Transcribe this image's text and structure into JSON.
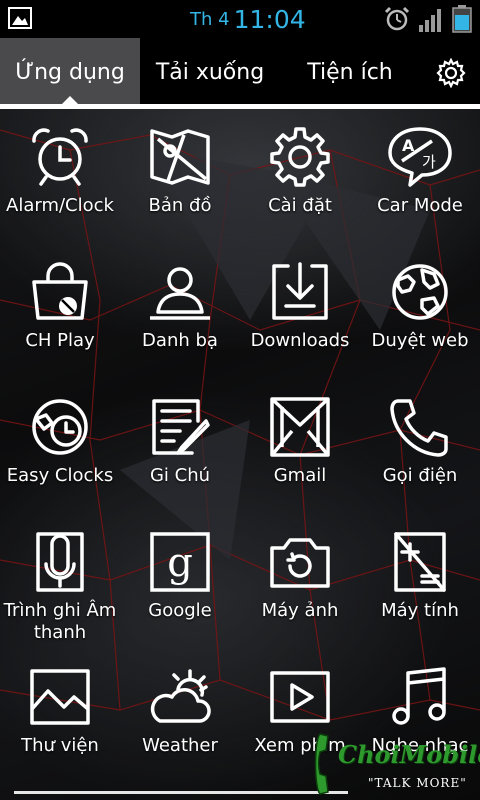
{
  "status_bar": {
    "day": "Th 4",
    "time": "11:04",
    "clock_color": "#33b5e5",
    "icons": [
      "image-notification-icon",
      "alarm-icon",
      "signal-icon",
      "battery-icon"
    ]
  },
  "tabs": [
    {
      "label": "Ứng dụng",
      "active": true
    },
    {
      "label": "Tải xuống",
      "active": false
    },
    {
      "label": "Tiện ích",
      "active": false
    }
  ],
  "settings_icon": "gear-icon",
  "apps": [
    {
      "label": "Alarm/Clock",
      "icon": "alarm-clock-icon"
    },
    {
      "label": "Bản đồ",
      "icon": "map-icon"
    },
    {
      "label": "Cài đặt",
      "icon": "gear-icon"
    },
    {
      "label": "Car Mode",
      "icon": "car-mode-icon"
    },
    {
      "label": "CH Play",
      "icon": "play-store-icon"
    },
    {
      "label": "Danh bạ",
      "icon": "contacts-icon"
    },
    {
      "label": "Downloads",
      "icon": "download-icon"
    },
    {
      "label": "Duyệt web",
      "icon": "globe-icon"
    },
    {
      "label": "Easy Clocks",
      "icon": "easy-clock-icon"
    },
    {
      "label": "Gi Chú",
      "icon": "notes-icon"
    },
    {
      "label": "Gmail",
      "icon": "gmail-icon"
    },
    {
      "label": "Gọi điện",
      "icon": "phone-icon"
    },
    {
      "label": "Trình ghi Âm thanh",
      "icon": "microphone-icon"
    },
    {
      "label": "Google",
      "icon": "google-icon"
    },
    {
      "label": "Máy ảnh",
      "icon": "camera-icon"
    },
    {
      "label": "Máy tính",
      "icon": "calculator-icon"
    },
    {
      "label": "Thư viện",
      "icon": "gallery-icon"
    },
    {
      "label": "Weather",
      "icon": "weather-icon"
    },
    {
      "label": "Xem phim",
      "icon": "video-player-icon"
    },
    {
      "label": "Nghe nhạc",
      "icon": "music-icon"
    }
  ],
  "watermark": {
    "name": "ChoiMobile",
    "tagline": "\"TALK MORE\"",
    "color": "#2e9a2e"
  }
}
